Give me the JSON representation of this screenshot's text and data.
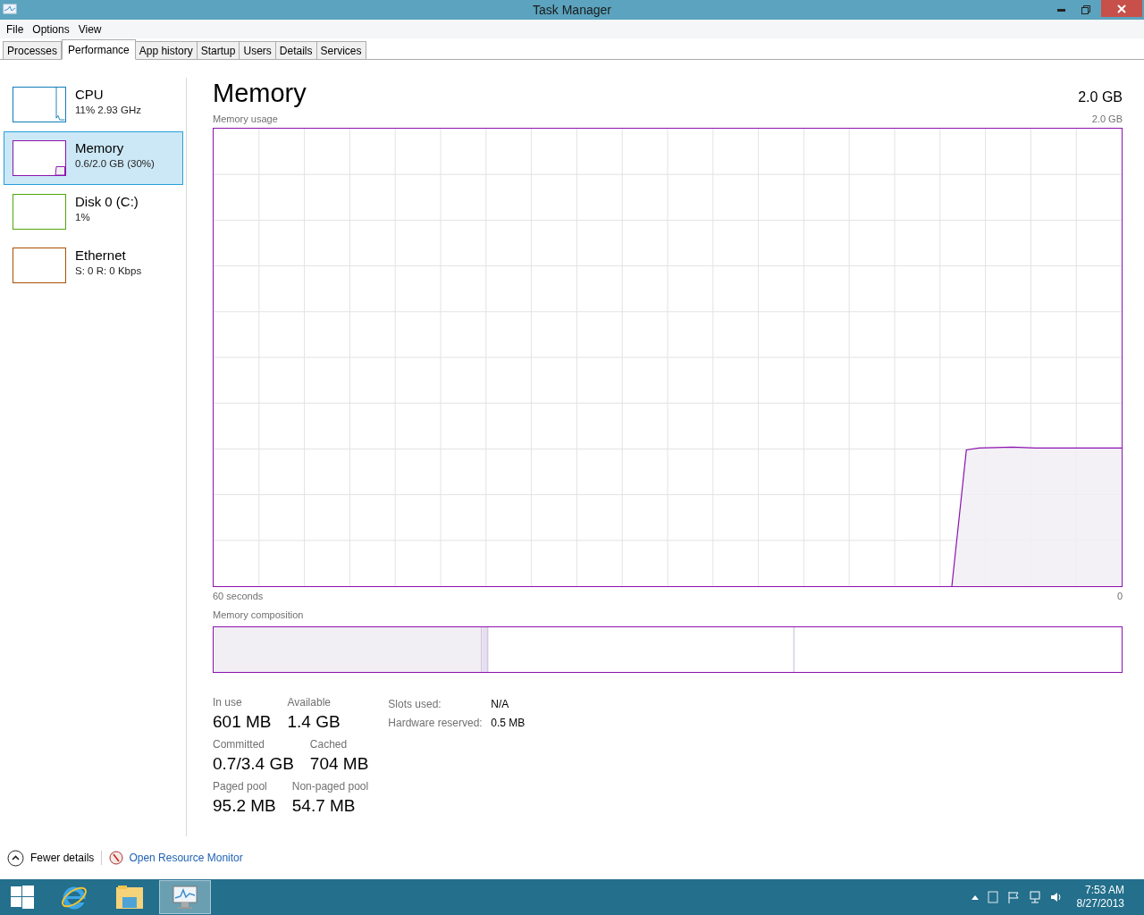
{
  "window": {
    "title": "Task Manager"
  },
  "menu": [
    "File",
    "Options",
    "View"
  ],
  "tabs": [
    {
      "label": "Processes",
      "selected": false
    },
    {
      "label": "Performance",
      "selected": true
    },
    {
      "label": "App history",
      "selected": false
    },
    {
      "label": "Startup",
      "selected": false
    },
    {
      "label": "Users",
      "selected": false
    },
    {
      "label": "Details",
      "selected": false
    },
    {
      "label": "Services",
      "selected": false
    }
  ],
  "sidebar": {
    "items": [
      {
        "kind": "cpu",
        "title": "CPU",
        "subtitle": "11% 2.93 GHz",
        "color": "#117dbb",
        "selected": false
      },
      {
        "kind": "memory",
        "title": "Memory",
        "subtitle": "0.6/2.0 GB (30%)",
        "color": "#8b12ae",
        "selected": true
      },
      {
        "kind": "disk",
        "title": "Disk 0 (C:)",
        "subtitle": "1%",
        "color": "#4da60c",
        "selected": false
      },
      {
        "kind": "network",
        "title": "Ethernet",
        "subtitle": "S: 0 R: 0 Kbps",
        "color": "#a74f01",
        "selected": false
      }
    ]
  },
  "main": {
    "heading": "Memory",
    "total": "2.0 GB",
    "usage": {
      "label": "Memory usage",
      "max": "2.0 GB",
      "x_start": "60 seconds",
      "x_end": "0"
    },
    "composition": {
      "label": "Memory composition"
    },
    "stats": [
      [
        {
          "label": "In use",
          "value": "601 MB"
        },
        {
          "label": "Available",
          "value": "1.4 GB"
        }
      ],
      [
        {
          "label": "Committed",
          "value": "0.7/3.4 GB"
        },
        {
          "label": "Cached",
          "value": "704 MB"
        }
      ],
      [
        {
          "label": "Paged pool",
          "value": "95.2 MB"
        },
        {
          "label": "Non-paged pool",
          "value": "54.7 MB"
        }
      ]
    ],
    "details": [
      {
        "label": "Slots used:",
        "value": "N/A"
      },
      {
        "label": "Hardware reserved:",
        "value": "0.5 MB"
      }
    ]
  },
  "footer": {
    "toggle": "Fewer details",
    "link": "Open Resource Monitor"
  },
  "taskbar": {
    "apps": [
      {
        "kind": "browser",
        "selected": false
      },
      {
        "kind": "folder",
        "selected": false
      },
      {
        "kind": "taskmgr",
        "selected": true
      }
    ],
    "time": "7:53 AM",
    "date": "8/27/2013"
  }
}
